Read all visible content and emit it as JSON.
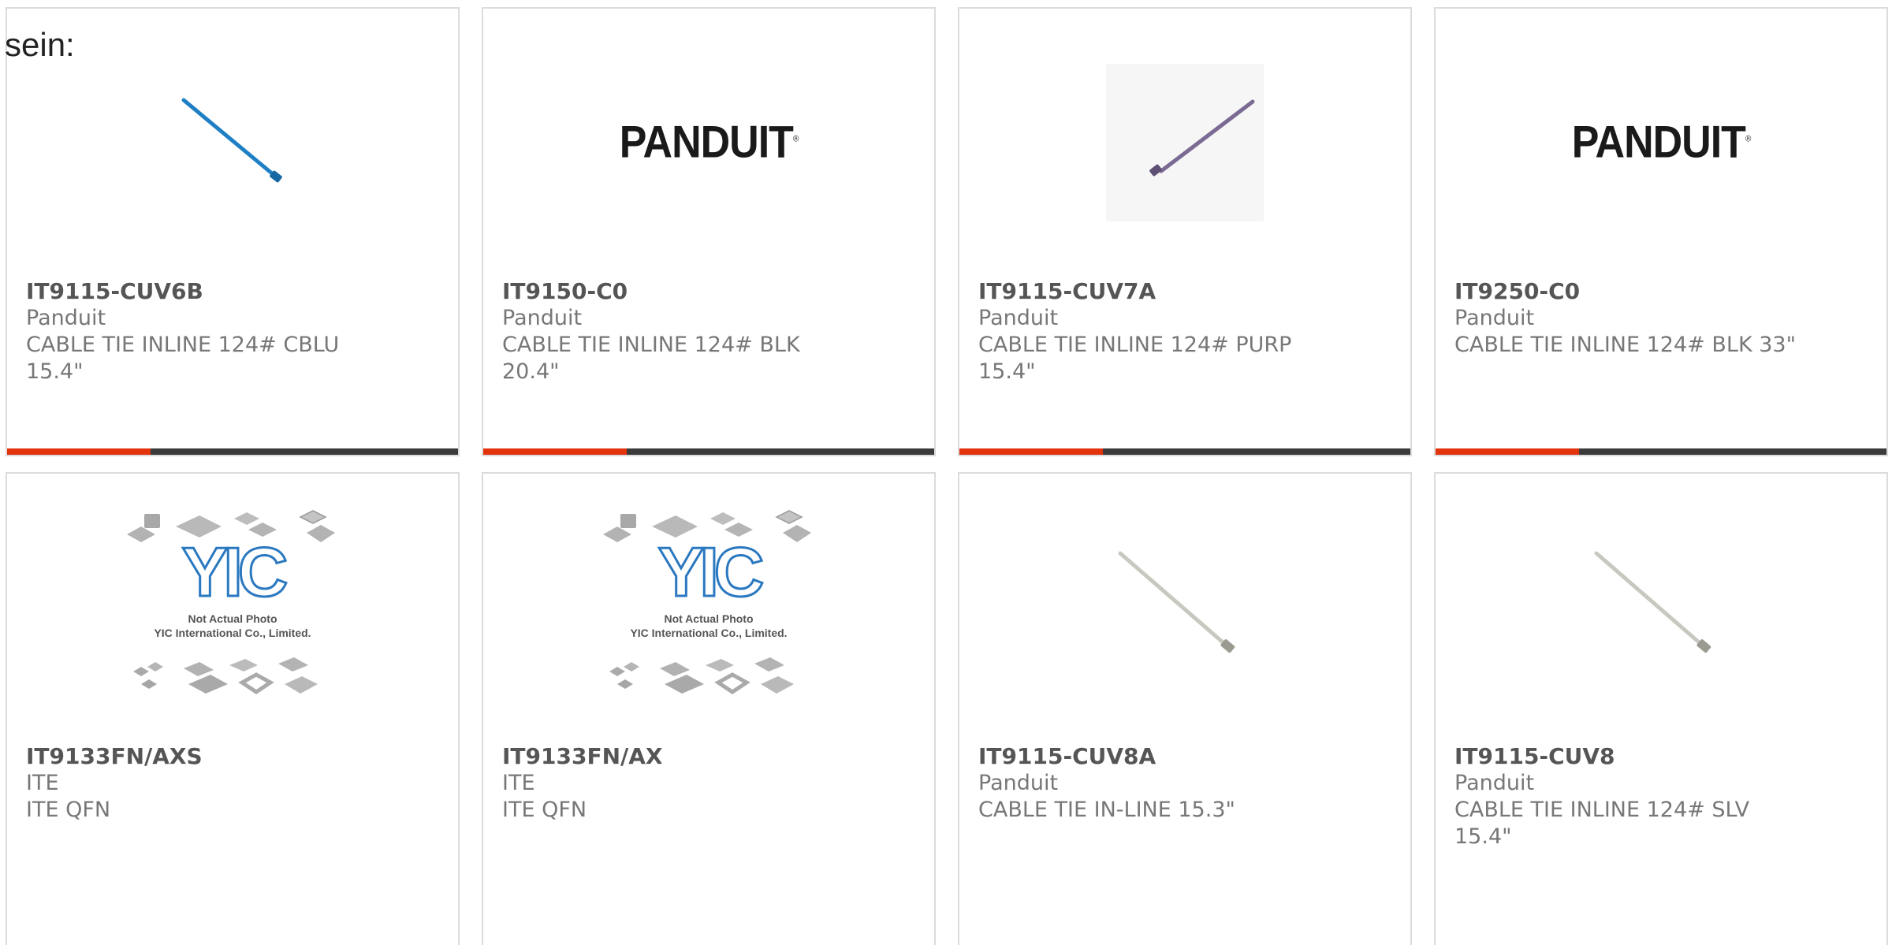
{
  "intro": "sein:",
  "products": [
    {
      "part": "IT9115-CUV6B",
      "maker": "Panduit",
      "desc": "CABLE TIE INLINE 124# CBLU\n15.4\"",
      "image": "cable-tie-blue"
    },
    {
      "part": "IT9150-C0",
      "maker": "Panduit",
      "desc": "CABLE TIE INLINE 124# BLK\n20.4\"",
      "image": "panduit-logo",
      "logo_text": "PANDUIT"
    },
    {
      "part": "IT9115-CUV7A",
      "maker": "Panduit",
      "desc": "CABLE TIE INLINE 124# PURP\n15.4\"",
      "image": "cable-tie-purple"
    },
    {
      "part": "IT9250-C0",
      "maker": "Panduit",
      "desc": "CABLE TIE INLINE 124# BLK 33\"",
      "image": "panduit-logo",
      "logo_text": "PANDUIT"
    },
    {
      "part": "IT9133FN/AXS",
      "maker": "ITE",
      "desc": "ITE QFN",
      "image": "yic-placeholder",
      "ph_line1": "Not Actual Photo",
      "ph_line2": "YIC International Co., Limited."
    },
    {
      "part": "IT9133FN/AX",
      "maker": "ITE",
      "desc": "ITE QFN",
      "image": "yic-placeholder",
      "ph_line1": "Not Actual Photo",
      "ph_line2": "YIC International Co., Limited."
    },
    {
      "part": "IT9115-CUV8A",
      "maker": "Panduit",
      "desc": "CABLE TIE IN-LINE 15.3\"",
      "image": "cable-tie-silver"
    },
    {
      "part": "IT9115-CUV8",
      "maker": "Panduit",
      "desc": "CABLE TIE INLINE 124# SLV\n15.4\"",
      "image": "cable-tie-silver"
    }
  ],
  "colors": {
    "accent": "#e2330d",
    "bar": "#3b3b3b",
    "border": "#dcdcdc"
  }
}
